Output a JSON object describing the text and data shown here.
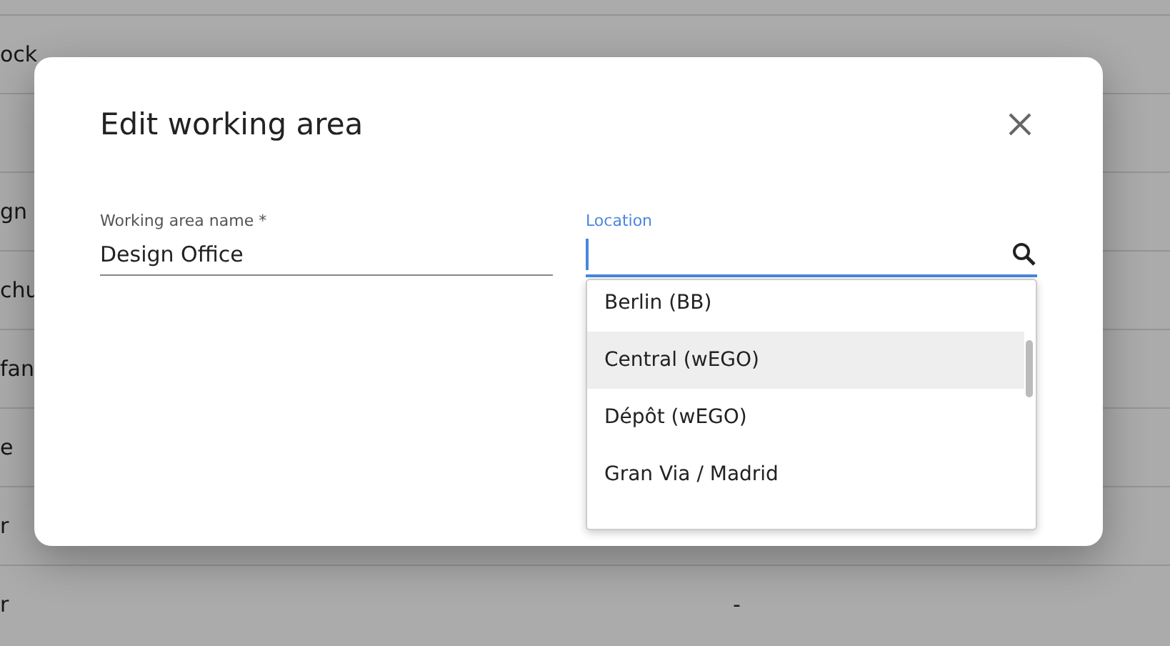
{
  "background_table": {
    "rows": [
      {
        "column_1": "ock"
      },
      {},
      {
        "column_1": "gn"
      },
      {
        "column_1": "chu"
      },
      {
        "column_1": "fan"
      },
      {
        "column_1": "e"
      },
      {
        "column_1": "r"
      },
      {
        "column_1": "r",
        "column_2": "-"
      }
    ]
  },
  "dialog": {
    "title": "Edit working area",
    "fields": [
      {
        "kind": "text",
        "label": "Working area name *",
        "value": "Design Office",
        "focused": false
      },
      {
        "kind": "search",
        "label": "Location",
        "focused": true
      }
    ],
    "options": [
      {
        "label": "Berlin (BB)",
        "highlighted": false
      },
      {
        "label": "Central (wEGO)",
        "highlighted": true
      },
      {
        "label": "Dépôt (wEGO)",
        "highlighted": false
      },
      {
        "label": "Gran Via / Madrid",
        "highlighted": false
      }
    ]
  }
}
